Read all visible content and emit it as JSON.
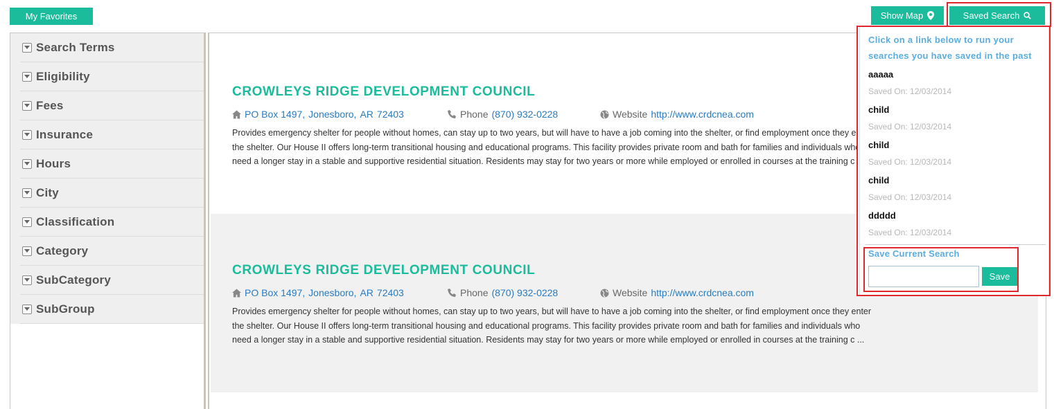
{
  "toolbar": {
    "favorites_label": "My Favorites",
    "show_map_label": "Show Map",
    "saved_search_label": "Saved Search"
  },
  "sidebar": {
    "filters": [
      {
        "label": "Search Terms"
      },
      {
        "label": "Eligibility"
      },
      {
        "label": "Fees"
      },
      {
        "label": "Insurance"
      },
      {
        "label": "Hours"
      },
      {
        "label": "City"
      },
      {
        "label": "Classification"
      },
      {
        "label": "Category"
      },
      {
        "label": "SubCategory"
      },
      {
        "label": "SubGroup"
      }
    ]
  },
  "results": [
    {
      "title": "CROWLEYS RIDGE DEVELOPMENT COUNCIL",
      "address": "PO Box 1497,",
      "city": "Jonesboro,",
      "state": "AR",
      "zip": "72403",
      "phone_label": "Phone",
      "phone": "(870) 932-0228",
      "website_label": "Website",
      "website": "http://www.crdcnea.com",
      "desc_lines": [
        "Provides emergency shelter for people without homes, can stay up to two years, but will have to have a job coming into the shelter, or find employment once they enter",
        "the shelter. Our House II offers long-term transitional housing and educational programs. This facility provides private room and bath for families and individuals who",
        "need a longer stay in a stable and supportive residential situation. Residents may stay for two years or more while employed or enrolled in courses at the training c ..."
      ]
    },
    {
      "title": "CROWLEYS RIDGE DEVELOPMENT COUNCIL",
      "address": "PO Box 1497,",
      "city": "Jonesboro,",
      "state": "AR",
      "zip": "72403",
      "phone_label": "Phone",
      "phone": "(870) 932-0228",
      "website_label": "Website",
      "website": "http://www.crdcnea.com",
      "desc_lines": [
        "Provides emergency shelter for people without homes, can stay up to two years, but will have to have a job coming into the shelter, or find employment once they enter",
        "the shelter. Our House II offers long-term transitional housing and educational programs. This facility provides private room and bath for families and individuals who",
        "need a longer stay in a stable and supportive residential situation. Residents may stay for two years or more while employed or enrolled in courses at the training c ..."
      ]
    }
  ],
  "saved_panel": {
    "intro_line1": "Click on a link below to run your",
    "intro_line2": "searches you have saved in the past",
    "items": [
      {
        "name": "aaaaa",
        "date": "Saved On: 12/03/2014"
      },
      {
        "name": "child",
        "date": "Saved On: 12/03/2014"
      },
      {
        "name": "child",
        "date": "Saved On: 12/03/2014"
      },
      {
        "name": "child",
        "date": "Saved On: 12/03/2014"
      },
      {
        "name": "ddddd",
        "date": "Saved On: 12/03/2014"
      }
    ],
    "save_current_label": "Save Current Search",
    "save_input_value": "",
    "save_button_label": "Save"
  },
  "colors": {
    "accent": "#1abc9c",
    "link": "#2a7bc0",
    "panel_heading": "#5aaddf",
    "highlight": "#e0262f"
  }
}
